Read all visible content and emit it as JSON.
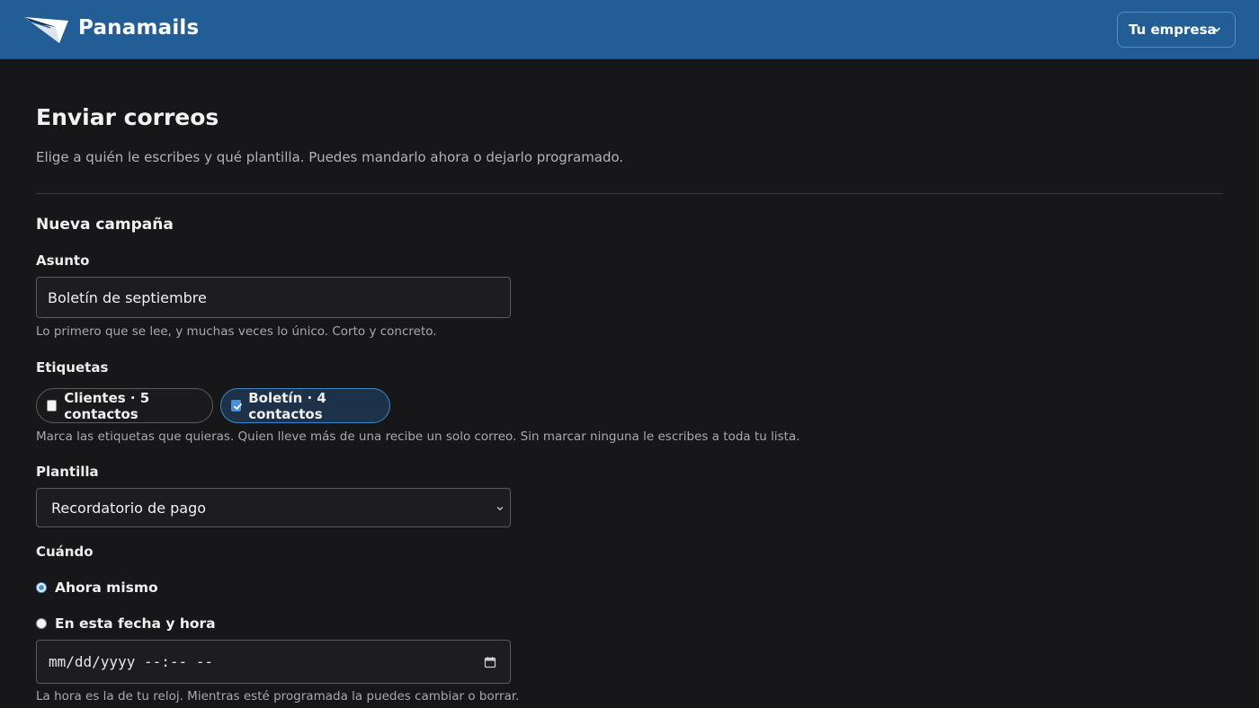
{
  "header": {
    "brand": "Panamails",
    "company_menu_label": "Tu empresa"
  },
  "page": {
    "title": "Enviar correos",
    "subtitle": "Elige a quién le escribes y qué plantilla. Puedes mandarlo ahora o dejarlo programado."
  },
  "campaign": {
    "section_title": "Nueva campaña",
    "subject": {
      "label": "Asunto",
      "value": "Boletín de septiembre",
      "help": "Lo primero que se lee, y muchas veces lo único. Corto y concreto."
    },
    "tags": {
      "label": "Etiquetas",
      "items": [
        {
          "label": "Clientes · 5 contactos",
          "checked": false
        },
        {
          "label": "Boletín · 4 contactos",
          "checked": true
        }
      ],
      "help": "Marca las etiquetas que quieras. Quien lleve más de una recibe un solo correo. Sin marcar ninguna le escribes a toda tu lista."
    },
    "template": {
      "label": "Plantilla",
      "selected": "Recordatorio de pago"
    },
    "schedule": {
      "label": "Cuándo",
      "options": [
        {
          "label": "Ahora mismo",
          "selected": true
        },
        {
          "label": "En esta fecha y hora",
          "selected": false
        }
      ],
      "datetime_placeholder": "mm/dd/yyyy --:-- --",
      "help": "La hora es la de tu reloj. Mientras esté programada la puedes cambiar o borrar."
    }
  },
  "colors": {
    "header_bg": "#225d95",
    "page_bg": "#171719",
    "accent": "#4a90d9"
  }
}
